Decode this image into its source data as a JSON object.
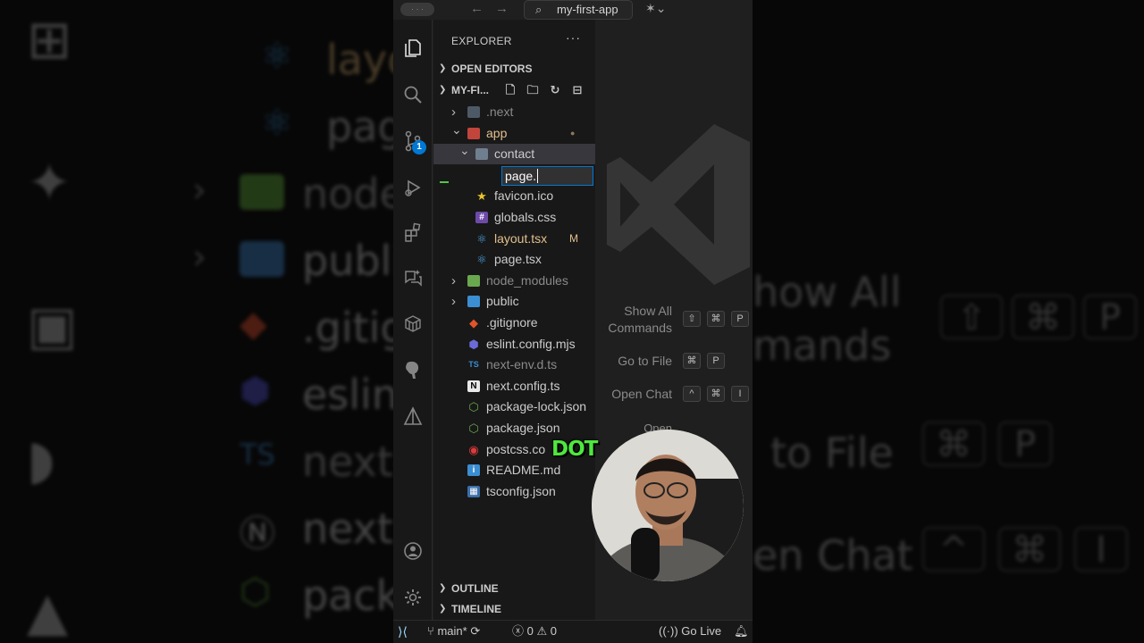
{
  "titlebar": {
    "search_text": "my-first-app"
  },
  "activity_bar": {
    "source_control_badge": "1"
  },
  "explorer": {
    "header": "EXPLORER",
    "more_label": "···",
    "open_editors_label": "OPEN EDITORS",
    "project_label": "MY-FI...",
    "rename_value": "page.",
    "tree": [
      {
        "name": ".next",
        "kind": "folder",
        "color": "#8a8a8a",
        "icon": "next-folder-icon"
      },
      {
        "name": "app",
        "kind": "folder",
        "color": "#e2c08d",
        "icon": "app-folder-icon",
        "mark": "●"
      },
      {
        "name": "contact",
        "kind": "folder",
        "color": "#cccccc",
        "icon": "folder-open-icon"
      },
      {
        "name": "favicon.ico",
        "kind": "file",
        "color": "#cccccc",
        "icon": "star-icon"
      },
      {
        "name": "globals.css",
        "kind": "file",
        "color": "#cccccc",
        "icon": "css-icon"
      },
      {
        "name": "layout.tsx",
        "kind": "file",
        "color": "#e2c08d",
        "icon": "react-icon",
        "mark": "M"
      },
      {
        "name": "page.tsx",
        "kind": "file",
        "color": "#cccccc",
        "icon": "react-icon"
      },
      {
        "name": "node_modules",
        "kind": "folder",
        "color": "#8a8a8a",
        "icon": "node-folder-icon"
      },
      {
        "name": "public",
        "kind": "folder",
        "color": "#cccccc",
        "icon": "public-folder-icon"
      },
      {
        "name": ".gitignore",
        "kind": "file",
        "color": "#cccccc",
        "icon": "git-icon"
      },
      {
        "name": "eslint.config.mjs",
        "kind": "file",
        "color": "#cccccc",
        "icon": "eslint-icon"
      },
      {
        "name": "next-env.d.ts",
        "kind": "file",
        "color": "#8a8a8a",
        "icon": "typescript-icon"
      },
      {
        "name": "next.config.ts",
        "kind": "file",
        "color": "#cccccc",
        "icon": "nextjs-icon"
      },
      {
        "name": "package-lock.json",
        "kind": "file",
        "color": "#cccccc",
        "icon": "nodejs-icon"
      },
      {
        "name": "package.json",
        "kind": "file",
        "color": "#cccccc",
        "icon": "nodejs-icon"
      },
      {
        "name": "postcss.co",
        "kind": "file",
        "color": "#cccccc",
        "icon": "postcss-icon"
      },
      {
        "name": "README.md",
        "kind": "file",
        "color": "#cccccc",
        "icon": "info-icon"
      },
      {
        "name": "tsconfig.json",
        "kind": "file",
        "color": "#cccccc",
        "icon": "tsconfig-icon"
      }
    ],
    "outline_label": "OUTLINE",
    "timeline_label": "TIMELINE"
  },
  "editor_hints": {
    "show_all_line1": "Show All",
    "show_all_line2": "Commands",
    "go_to_file": "Go to File",
    "open_chat": "Open Chat",
    "open_partial": "Open"
  },
  "statusbar": {
    "branch": "main*",
    "errors": "0",
    "warnings": "0",
    "go_live": "Go Live"
  },
  "caption": "DOT",
  "background": {
    "left_rows": [
      "layo",
      "pag",
      "node",
      "publi",
      ".gitig",
      "eslint",
      "next-",
      "next.",
      "pack"
    ],
    "right_rows": [
      "how All",
      "mands",
      "to File",
      "en Chat"
    ]
  },
  "colors": {
    "accent_blue": "#0078d4",
    "modified": "#e2c08d",
    "caption_green": "#4ee83e"
  }
}
